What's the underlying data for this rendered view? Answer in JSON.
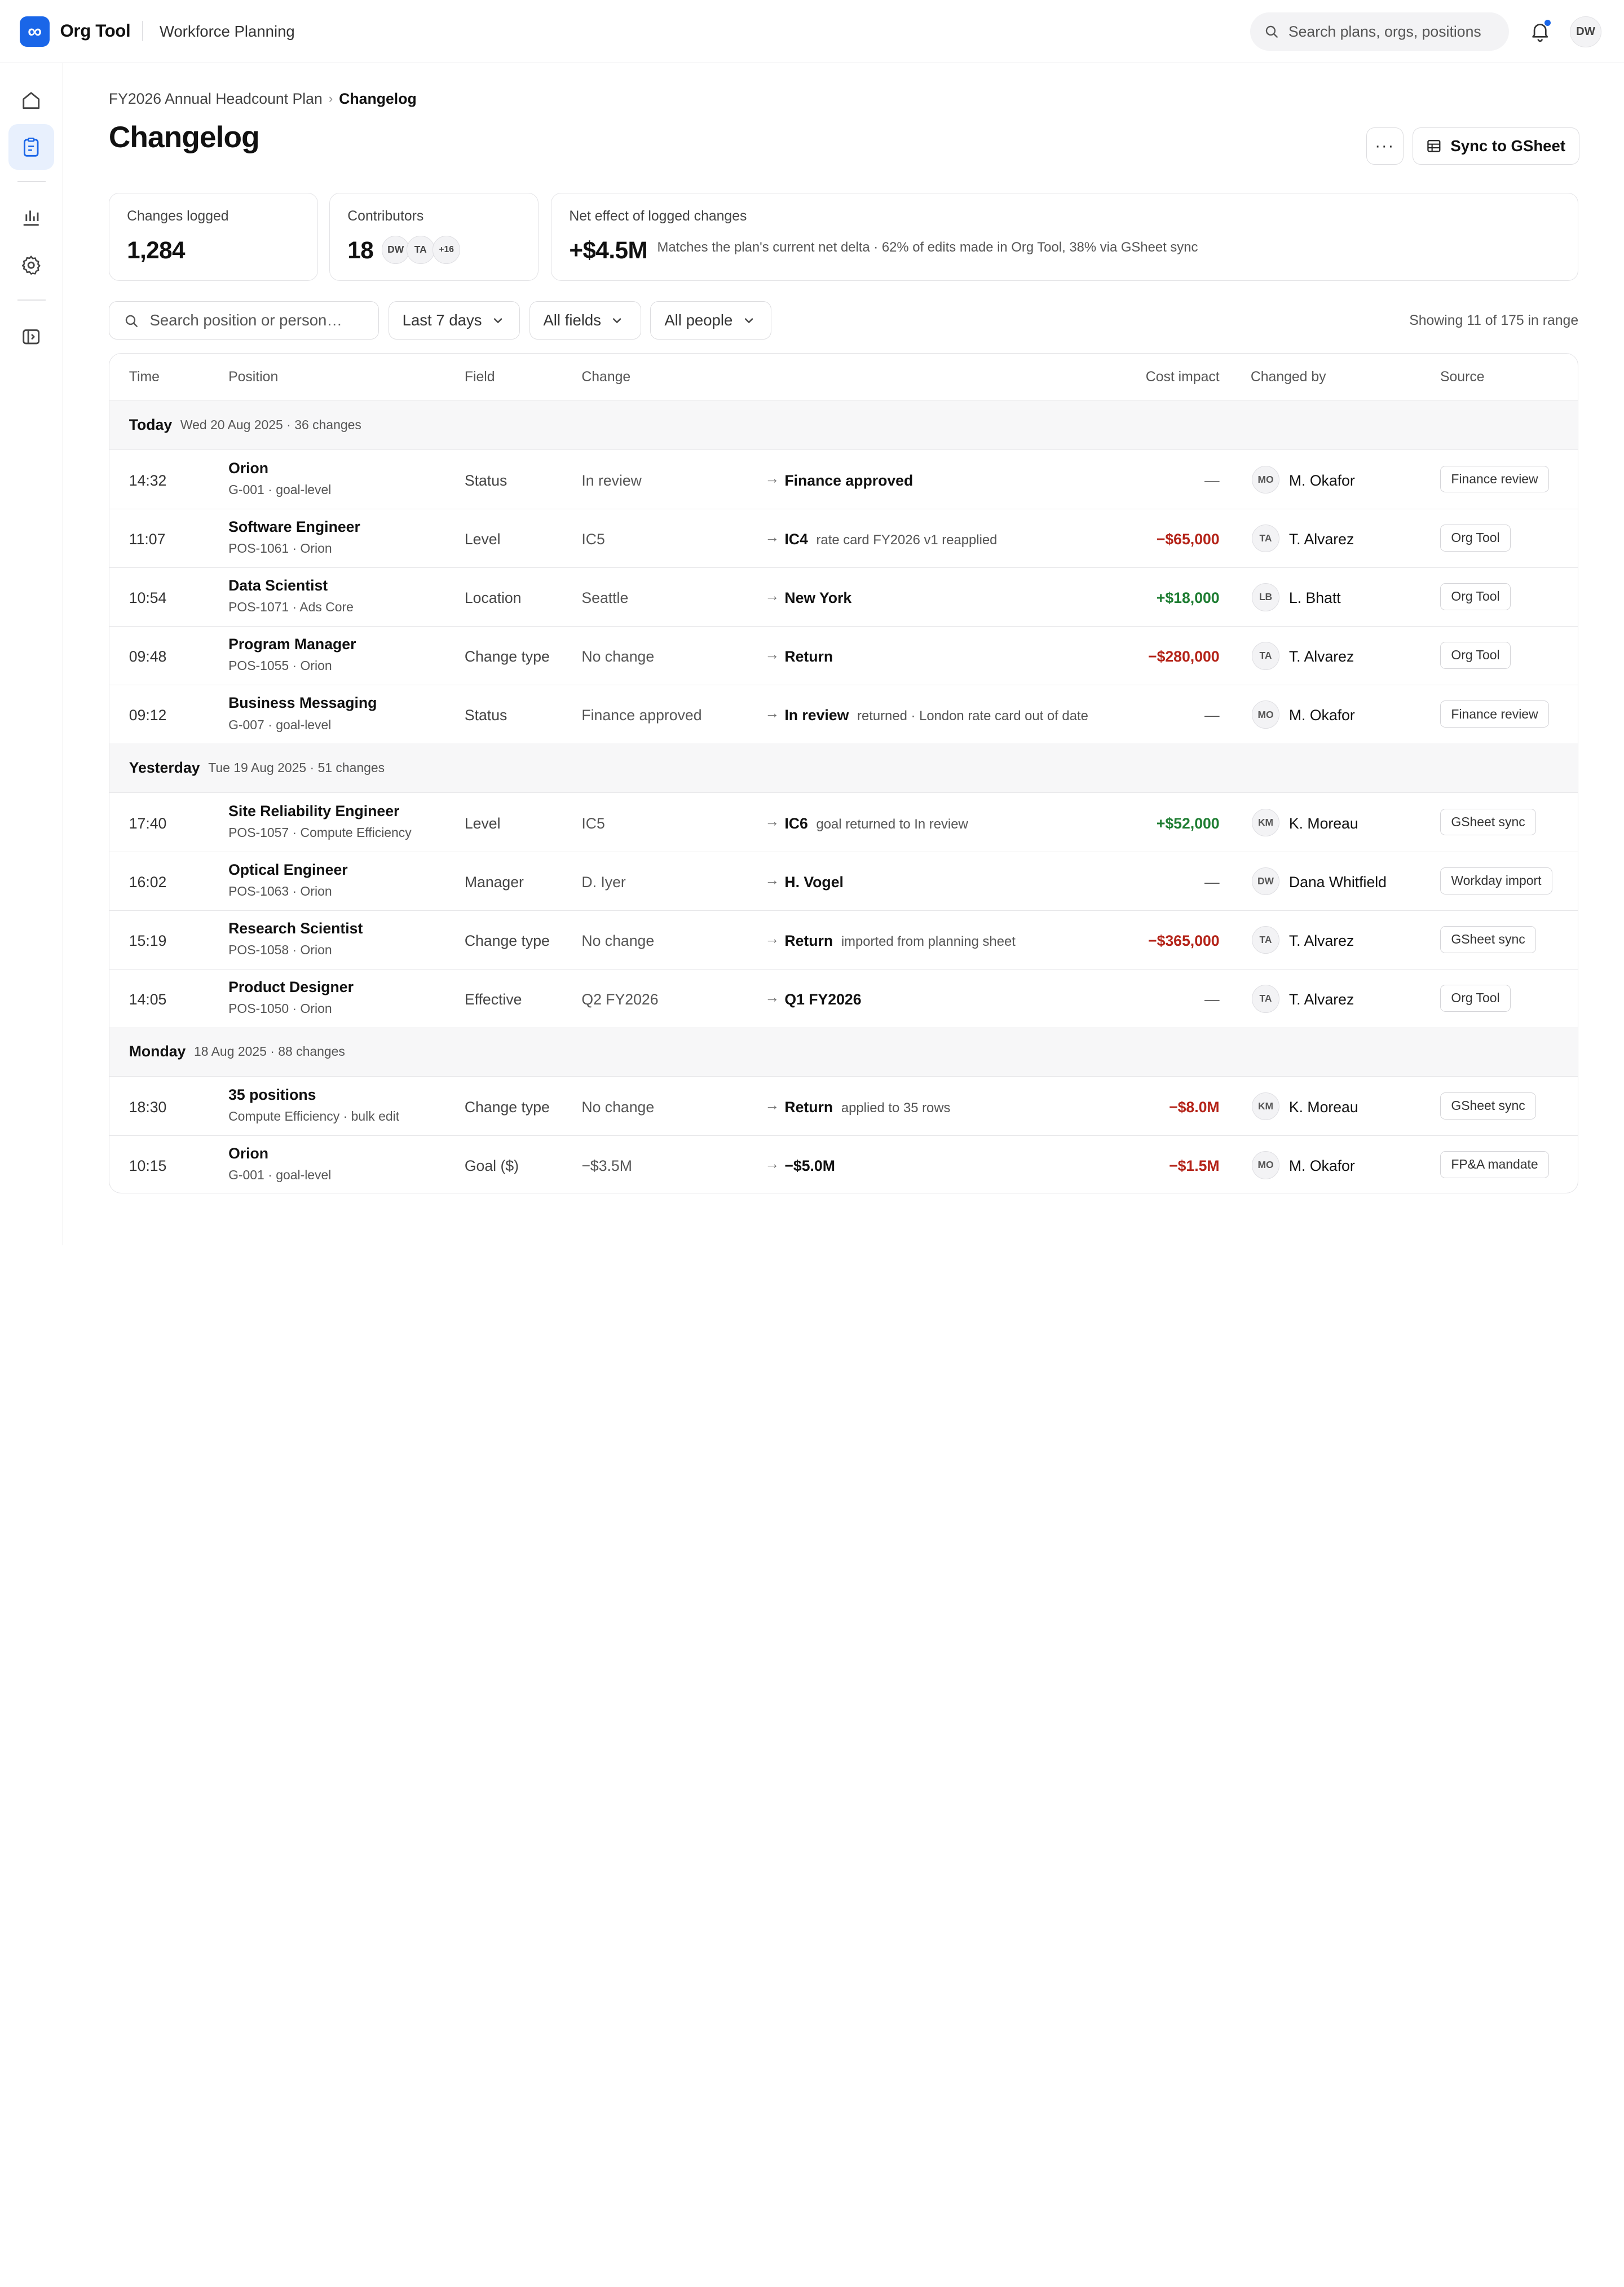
{
  "app": {
    "logo_glyph": "∞",
    "name": "Org Tool",
    "section": "Workforce Planning",
    "brand_color": "#1a66e8"
  },
  "topbar": {
    "search_placeholder": "Search plans, orgs, positions",
    "user_initials": "DW"
  },
  "sidebar": {
    "items": [
      "home-icon",
      "clipboard-icon",
      "bar-chart-icon",
      "gear-icon",
      "sidebar-toggle-icon"
    ],
    "active": "clipboard-icon"
  },
  "breadcrumb": {
    "parent": "FY2026 Annual Headcount Plan",
    "separator": "›",
    "current": "Changelog"
  },
  "page": {
    "title": "Changelog",
    "more_label": "···",
    "sync_label": "Sync to GSheet"
  },
  "stats": {
    "changes": {
      "label": "Changes logged",
      "value": "1,284"
    },
    "contributors": {
      "label": "Contributors",
      "value": "18",
      "avatars": [
        "DW",
        "TA",
        "+16"
      ]
    },
    "net": {
      "label": "Net effect of logged changes",
      "value": "+$4.5M",
      "note": "Matches the plan's current net delta · 62% of edits made in Org Tool, 38% via GSheet sync"
    }
  },
  "filters": {
    "search_placeholder": "Search position or person…",
    "range": "Last 7 days",
    "fields": "All fields",
    "people": "All people",
    "showing": "Showing 11 of 175 in range"
  },
  "table": {
    "headers": {
      "time": "Time",
      "position": "Position",
      "field": "Field",
      "change": "Change",
      "cost": "Cost impact",
      "by": "Changed by",
      "source": "Source"
    },
    "arrow": "→",
    "groups": [
      {
        "title": "Today",
        "meta": "Wed 20 Aug 2025 · 36 changes"
      },
      {
        "title": "Yesterday",
        "meta": "Tue 19 Aug 2025 · 51 changes"
      },
      {
        "title": "Monday",
        "meta": "18 Aug 2025 · 88 changes"
      }
    ],
    "rows": [
      {
        "time": "14:32",
        "position": "Orion",
        "sub": "G-001 · goal-level",
        "field": "Status",
        "old": "In review",
        "new": "Finance approved",
        "note": "",
        "cost": "—",
        "cost_kind": "none",
        "initials": "MO",
        "person": "M. Okafor",
        "source": "Finance review"
      },
      {
        "time": "11:07",
        "position": "Software Engineer",
        "sub": "POS-1061 · Orion",
        "field": "Level",
        "old": "IC5",
        "new": "IC4",
        "note": "rate card FY2026 v1 reapplied",
        "cost": "−$65,000",
        "cost_kind": "neg",
        "initials": "TA",
        "person": "T. Alvarez",
        "source": "Org Tool"
      },
      {
        "time": "10:54",
        "position": "Data Scientist",
        "sub": "POS-1071 · Ads Core",
        "field": "Location",
        "old": "Seattle",
        "new": "New York",
        "note": "",
        "cost": "+$18,000",
        "cost_kind": "pos",
        "initials": "LB",
        "person": "L. Bhatt",
        "source": "Org Tool"
      },
      {
        "time": "09:48",
        "position": "Program Manager",
        "sub": "POS-1055 · Orion",
        "field": "Change type",
        "old": "No change",
        "new": "Return",
        "note": "",
        "cost": "−$280,000",
        "cost_kind": "neg",
        "initials": "TA",
        "person": "T. Alvarez",
        "source": "Org Tool"
      },
      {
        "time": "09:12",
        "position": "Business Messaging",
        "sub": "G-007 · goal-level",
        "field": "Status",
        "old": "Finance approved",
        "new": "In review",
        "note": "returned · London rate card out of date",
        "cost": "—",
        "cost_kind": "none",
        "initials": "MO",
        "person": "M. Okafor",
        "source": "Finance review"
      },
      {
        "time": "17:40",
        "position": "Site Reliability Engineer",
        "sub": "POS-1057 · Compute Efficiency",
        "field": "Level",
        "old": "IC5",
        "new": "IC6",
        "note": "goal returned to In review",
        "cost": "+$52,000",
        "cost_kind": "pos",
        "initials": "KM",
        "person": "K. Moreau",
        "source": "GSheet sync"
      },
      {
        "time": "16:02",
        "position": "Optical Engineer",
        "sub": "POS-1063 · Orion",
        "field": "Manager",
        "old": "D. Iyer",
        "new": "H. Vogel",
        "note": "",
        "cost": "—",
        "cost_kind": "none",
        "initials": "DW",
        "person": "Dana Whitfield",
        "source": "Workday import"
      },
      {
        "time": "15:19",
        "position": "Research Scientist",
        "sub": "POS-1058 · Orion",
        "field": "Change type",
        "old": "No change",
        "new": "Return",
        "note": "imported from planning sheet",
        "cost": "−$365,000",
        "cost_kind": "neg",
        "initials": "TA",
        "person": "T. Alvarez",
        "source": "GSheet sync"
      },
      {
        "time": "14:05",
        "position": "Product Designer",
        "sub": "POS-1050 · Orion",
        "field": "Effective",
        "old": "Q2 FY2026",
        "new": "Q1 FY2026",
        "note": "",
        "cost": "—",
        "cost_kind": "none",
        "initials": "TA",
        "person": "T. Alvarez",
        "source": "Org Tool"
      },
      {
        "time": "18:30",
        "position": "35 positions",
        "sub": "Compute Efficiency · bulk edit",
        "field": "Change type",
        "old": "No change",
        "new": "Return",
        "note": "applied to 35 rows",
        "cost": "−$8.0M",
        "cost_kind": "neg",
        "initials": "KM",
        "person": "K. Moreau",
        "source": "GSheet sync"
      },
      {
        "time": "10:15",
        "position": "Orion",
        "sub": "G-001 · goal-level",
        "field": "Goal ($)",
        "old": "−$3.5M",
        "new": "−$5.0M",
        "note": "",
        "cost": "−$1.5M",
        "cost_kind": "neg",
        "initials": "MO",
        "person": "M. Okafor",
        "source": "FP&A mandate"
      }
    ]
  }
}
